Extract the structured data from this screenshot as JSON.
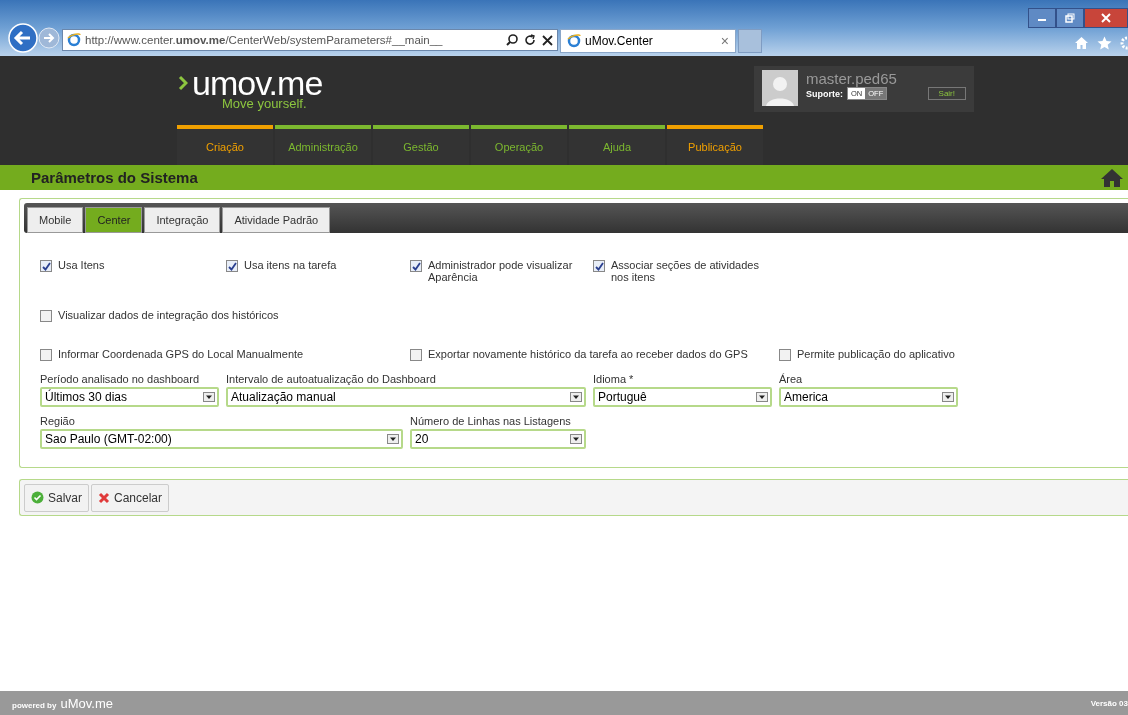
{
  "browser": {
    "url": "http://www.center.**umov.me**/CenterWeb/systemParameters#__main__",
    "tab": {
      "title": "uMov.Center",
      "close": "×"
    }
  },
  "header": {
    "logo": "umov.me",
    "slogan": "Move yourself.",
    "user": {
      "name": "master.ped65",
      "support_label": "Suporte:",
      "toggle": [
        {
          "label": "ON",
          "selected": false
        },
        {
          "label": "OFF",
          "selected": true
        }
      ],
      "logout": "Sair!"
    }
  },
  "nav": [
    {
      "label": "Criação",
      "color": "#f0a000"
    },
    {
      "label": "Administração",
      "color": "#7cb82f"
    },
    {
      "label": "Gestão",
      "color": "#7cb82f"
    },
    {
      "label": "Operação",
      "color": "#7cb82f"
    },
    {
      "label": "Ajuda",
      "color": "#7cb82f"
    },
    {
      "label": "Publicação",
      "color": "#f0a000"
    }
  ],
  "page_title": "Parâmetros do Sistema",
  "tabs": [
    {
      "label": "Mobile",
      "selected": false
    },
    {
      "label": "Center",
      "selected": true
    },
    {
      "label": "Integração",
      "selected": false
    },
    {
      "label": "Atividade Padrão",
      "selected": false
    }
  ],
  "checkbox_rows": [
    [
      {
        "label": "Usa Itens",
        "checked": true
      },
      {
        "label": "Usa itens na tarefa",
        "checked": true
      },
      {
        "label": "Administrador pode visualizar Aparência",
        "checked": true
      },
      {
        "label": "Associar seções de atividades nos itens",
        "checked": true
      }
    ],
    [
      {
        "label": "Visualizar dados de integração dos históricos",
        "checked": false
      }
    ],
    [
      {
        "label": "Informar Coordenada GPS do Local Manualmente",
        "checked": false
      },
      {
        "label": "Exportar novamente histórico da tarefa ao receber dados do GPS",
        "checked": false
      },
      {
        "label": "Permite publicação do aplicativo",
        "checked": false
      }
    ]
  ],
  "field_rows": [
    [
      {
        "label": "Período analisado no dashboard",
        "value": "Últimos 30 dias"
      },
      {
        "label": "Intervalo de autoatualização do Dashboard",
        "value": "Atualização manual"
      },
      {
        "label": "Idioma *",
        "value": "Portuguê"
      },
      {
        "label": "Área",
        "value": "America"
      }
    ],
    [
      {
        "label": "Região",
        "value": "Sao Paulo (GMT-02:00)"
      },
      {
        "label": "Número de Linhas nas Listagens",
        "value": "20"
      }
    ]
  ],
  "buttons": [
    {
      "label": "Salvar",
      "kind": "save"
    },
    {
      "label": "Cancelar",
      "kind": "cancel"
    }
  ],
  "footer": {
    "powered_by": "powered by",
    "brand": "uMov.me",
    "version": "Versão 03"
  }
}
